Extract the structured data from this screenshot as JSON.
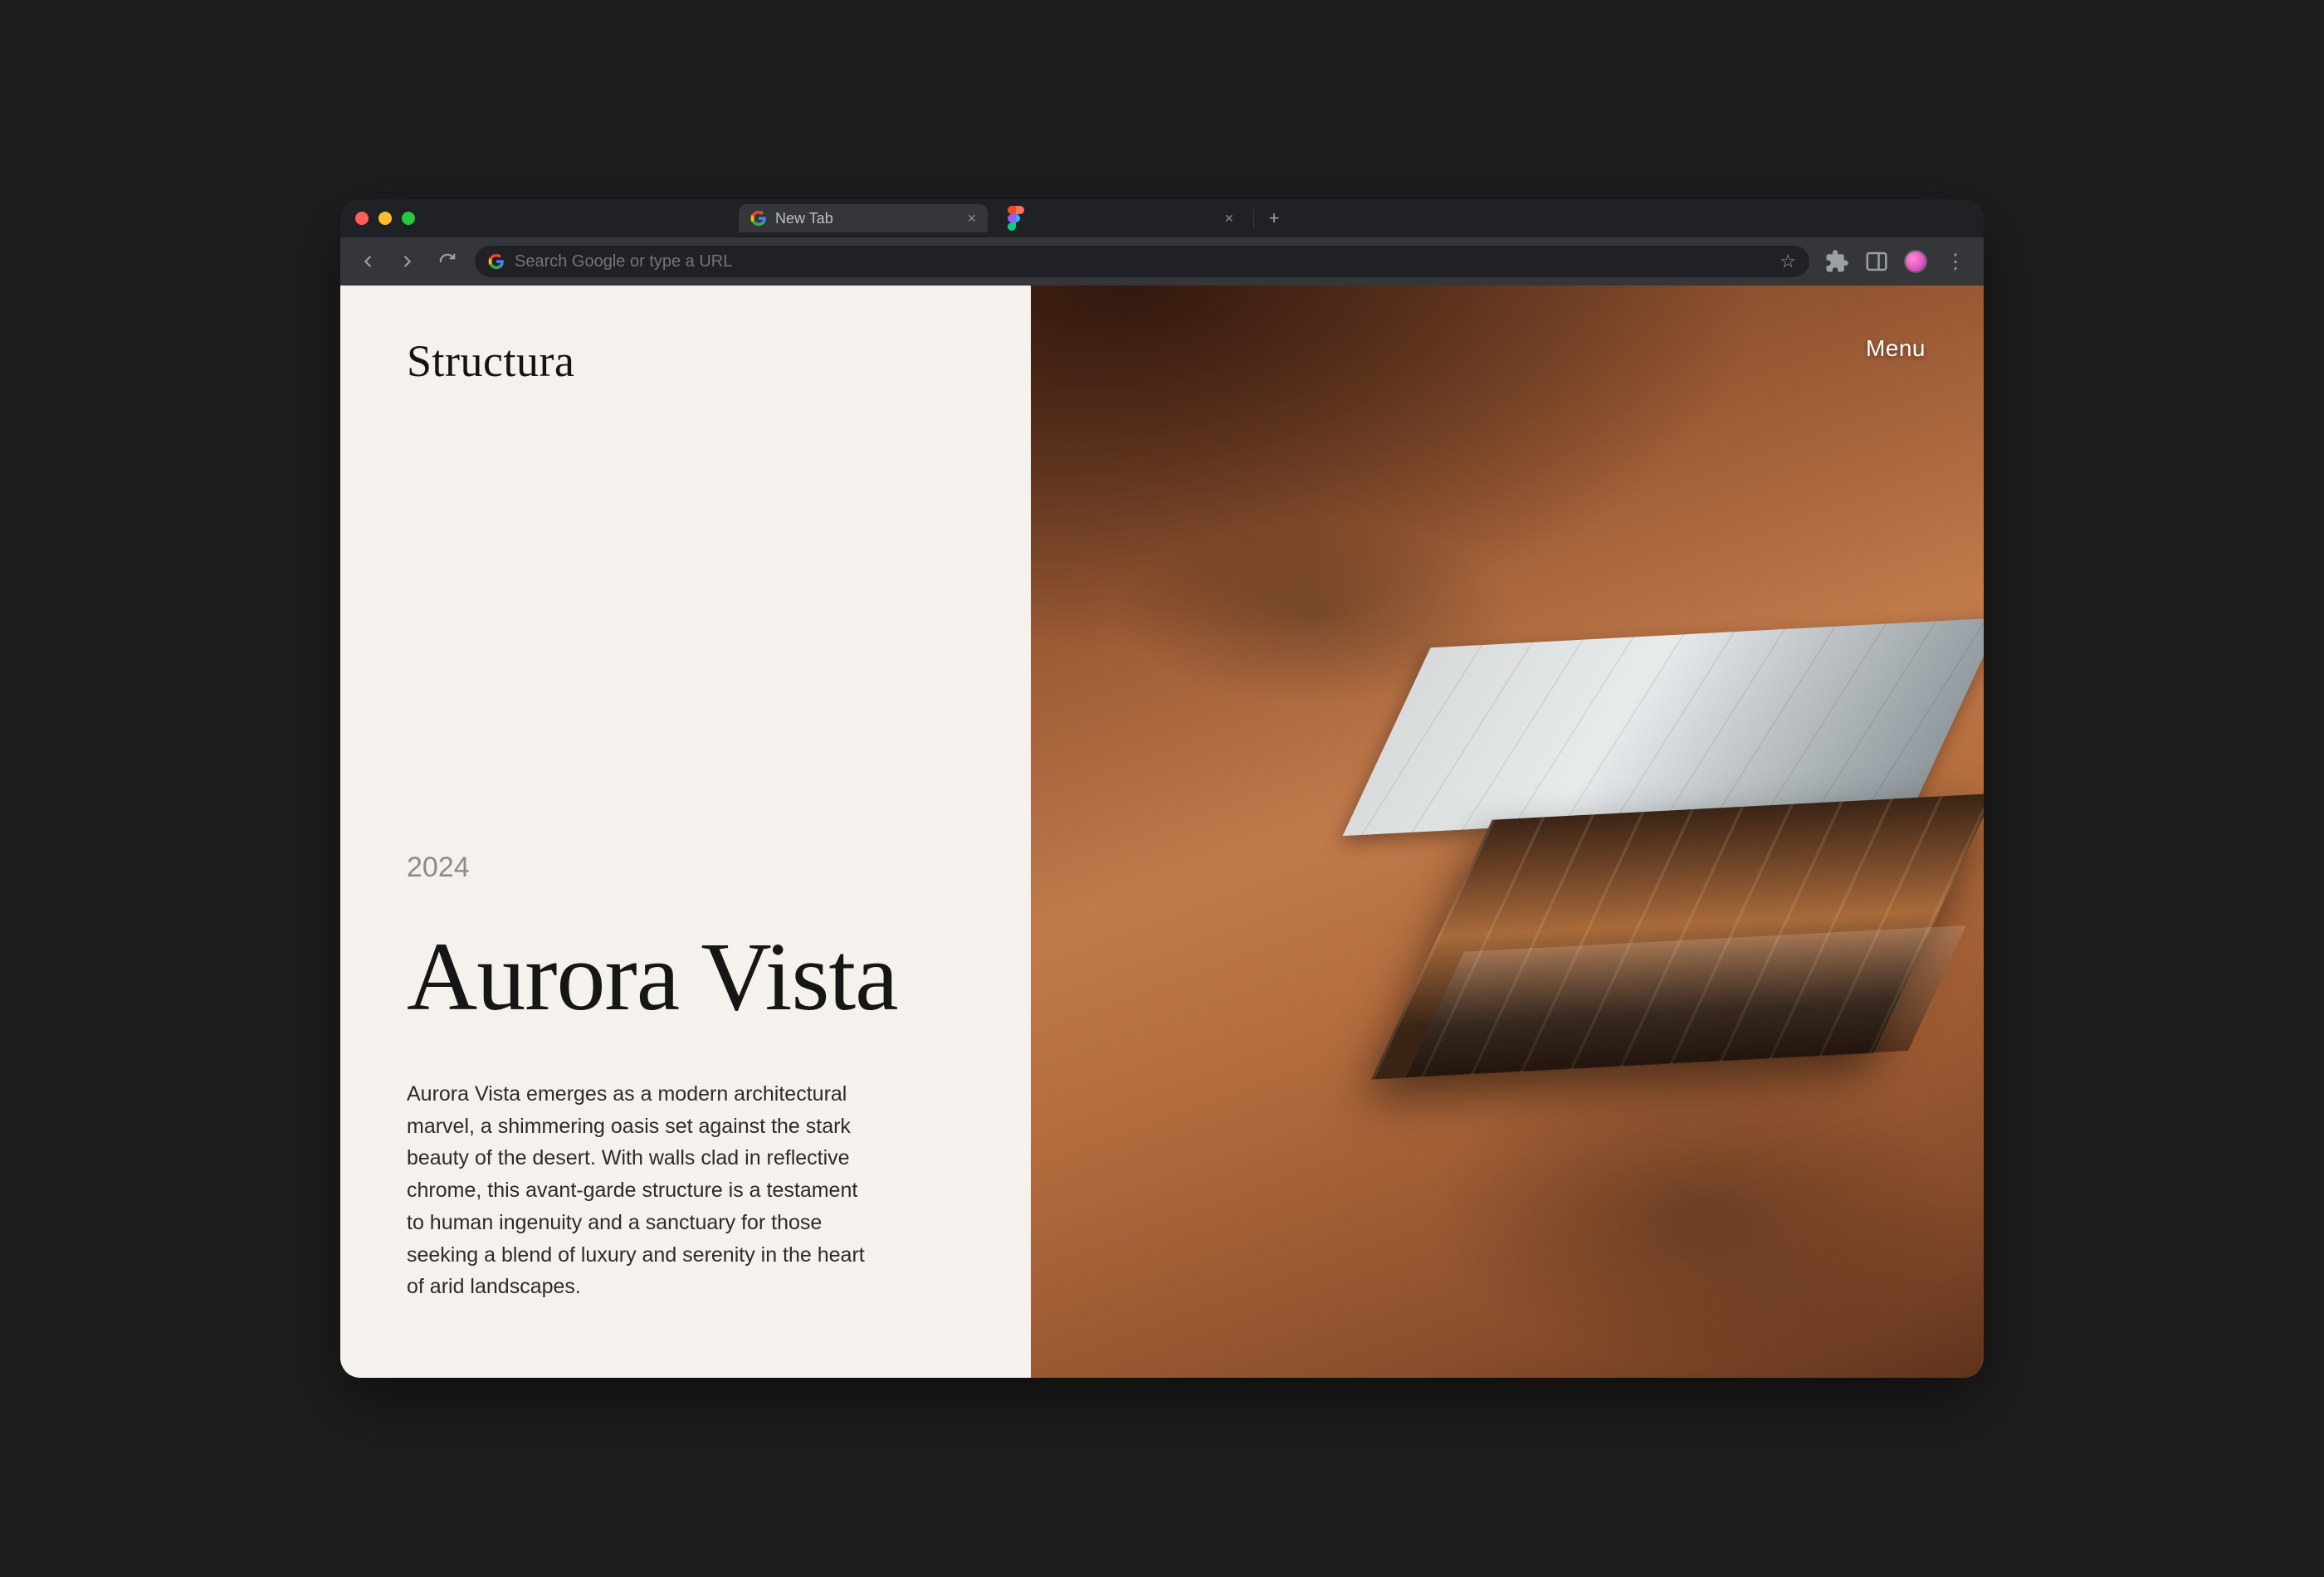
{
  "browser": {
    "tabs": [
      {
        "label": "New Tab",
        "favicon": "google"
      },
      {
        "label": "",
        "favicon": "figma"
      }
    ],
    "omnibox_placeholder": "Search Google or type a URL"
  },
  "page": {
    "brand": "Structura",
    "menu_label": "Menu",
    "year": "2024",
    "project_title": "Aurora Vista",
    "project_description": "Aurora Vista emerges as a modern architectural marvel, a shimmering oasis set against the stark beauty of the desert. With walls clad in reflective chrome, this avant-garde structure is a testament to human ingenuity and a sanctuary for those seeking a blend of luxury and serenity in the heart of arid landscapes."
  }
}
